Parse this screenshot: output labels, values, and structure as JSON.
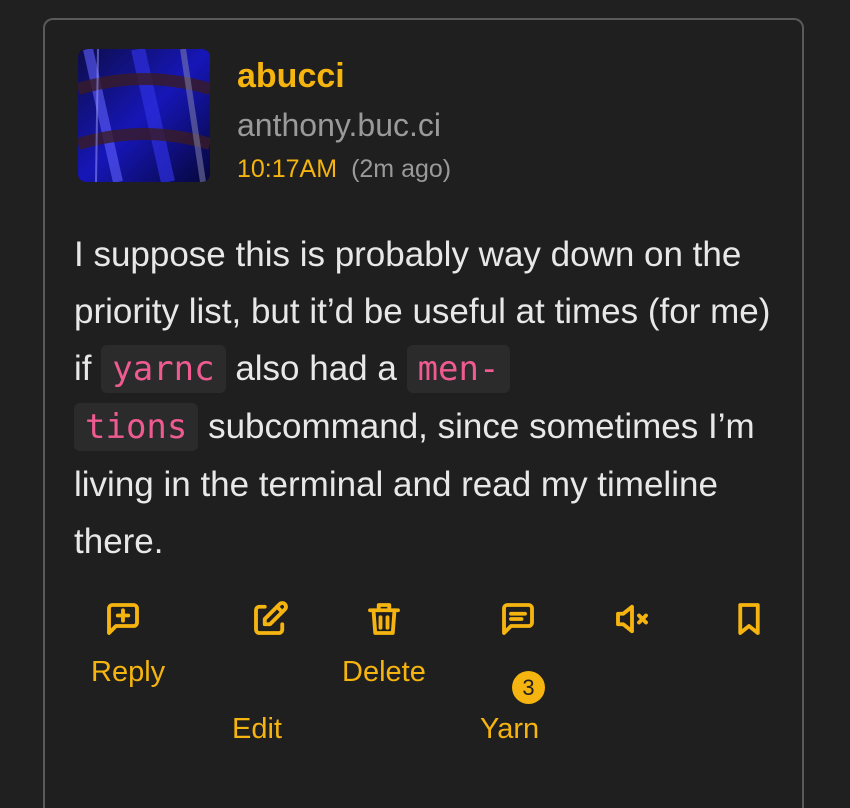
{
  "post": {
    "author": "abucci",
    "host": "anthony.buc.ci",
    "time": "10:17AM",
    "ago": "(2m ago)",
    "body": {
      "t1": "I suppose this is probably way down on the priority list, but it’d be useful at times (for me) if ",
      "code1": "yarnc",
      "t2": " also had a ",
      "code2a": "men-",
      "code2b": "tions",
      "t3": " subcommand, since sometimes I’m living in the terminal and read my timeline there."
    }
  },
  "actions": {
    "reply": {
      "label": "Reply",
      "icon": "message-plus-icon"
    },
    "edit": {
      "label": "Edit",
      "icon": "edit-icon"
    },
    "delete": {
      "label": "Delete",
      "icon": "trash-icon"
    },
    "yarn": {
      "label": "Yarn",
      "icon": "message-icon",
      "count": "3"
    },
    "mute": {
      "icon": "volume-mute-icon"
    },
    "bookmark": {
      "icon": "bookmark-icon"
    }
  },
  "colors": {
    "accent": "#f5b40f",
    "code": "#ef5b91",
    "background": "#1f1f1f"
  }
}
